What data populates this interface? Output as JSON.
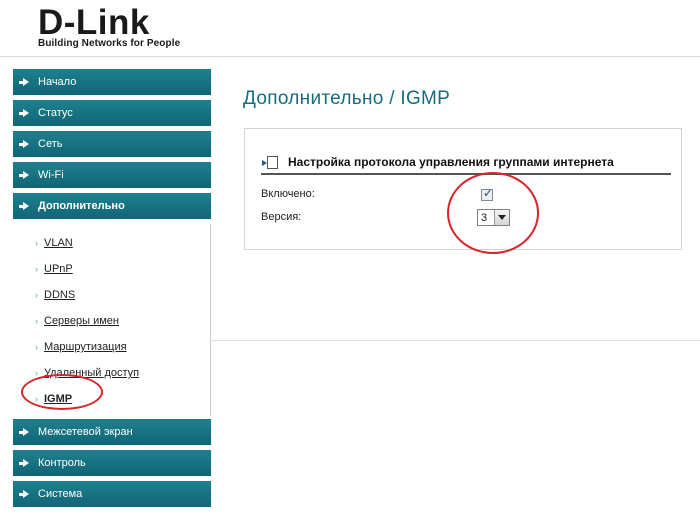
{
  "brand": {
    "name": "D-Link",
    "tagline": "Building Networks for People"
  },
  "sidebar": {
    "items": [
      {
        "label": "Начало"
      },
      {
        "label": "Статус"
      },
      {
        "label": "Сеть"
      },
      {
        "label": "Wi-Fi"
      },
      {
        "label": "Дополнительно"
      },
      {
        "label": "Межсетевой экран"
      },
      {
        "label": "Контроль"
      },
      {
        "label": "Система"
      }
    ],
    "submenu": [
      {
        "label": "VLAN"
      },
      {
        "label": "UPnP"
      },
      {
        "label": "DDNS"
      },
      {
        "label": "Серверы имен"
      },
      {
        "label": "Маршрутизация"
      },
      {
        "label": "Удаленный доступ"
      },
      {
        "label": "IGMP"
      }
    ]
  },
  "main": {
    "title": "Дополнительно  / IGMP",
    "section_title": "Настройка протокола управления группами интернета",
    "enabled_label": "Включено:",
    "enabled_checked": true,
    "version_label": "Версия:",
    "version_value": "3"
  },
  "colors": {
    "nav_bg": "#1a7585",
    "title": "#146c80",
    "annotation": "#d8242a"
  }
}
